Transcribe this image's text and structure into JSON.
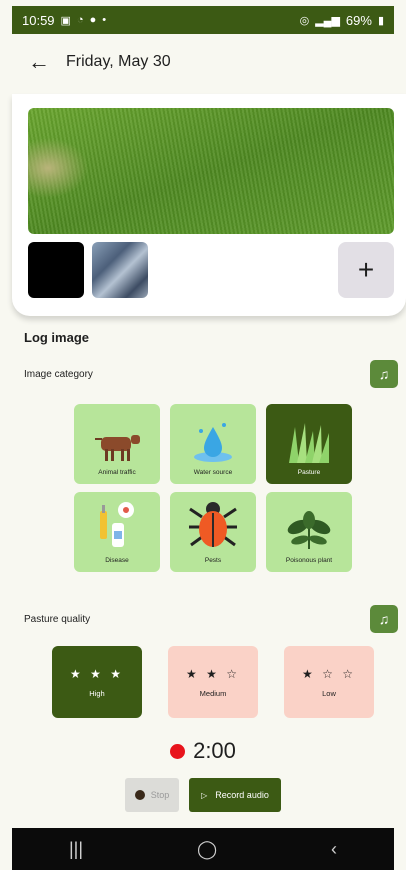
{
  "status_bar": {
    "time": "10:59",
    "battery": "69%"
  },
  "header": {
    "title": "Friday, May 30"
  },
  "photos": {
    "add_label": "+"
  },
  "log_image": {
    "title": "Log image",
    "category_label": "Image category",
    "categories": [
      {
        "label": "Animal traffic",
        "icon": "cow-icon",
        "selected": false
      },
      {
        "label": "Water source",
        "icon": "water-drop-icon",
        "selected": false
      },
      {
        "label": "Pasture",
        "icon": "grass-icon",
        "selected": true
      },
      {
        "label": "Disease",
        "icon": "medicine-icon",
        "selected": false
      },
      {
        "label": "Pests",
        "icon": "beetle-icon",
        "selected": false
      },
      {
        "label": "Poisonous plant",
        "icon": "plant-icon",
        "selected": false
      }
    ]
  },
  "pasture_quality": {
    "label": "Pasture quality",
    "options": [
      {
        "stars": "★ ★ ★",
        "label": "High",
        "selected": true
      },
      {
        "stars": "★ ★ ☆",
        "label": "Medium",
        "selected": false
      },
      {
        "stars": "★ ☆ ☆",
        "label": "Low",
        "selected": false
      }
    ]
  },
  "recorder": {
    "timer": "2:00",
    "stop_label": "Stop",
    "record_label": "Record audio"
  },
  "nav": {
    "recents": "|||",
    "home": "◯",
    "back": "‹"
  },
  "colors": {
    "primary": "#3c5a14",
    "tile": "#b7e59a",
    "quality_tile": "#fad2c7",
    "record_dot": "#e8141c"
  }
}
